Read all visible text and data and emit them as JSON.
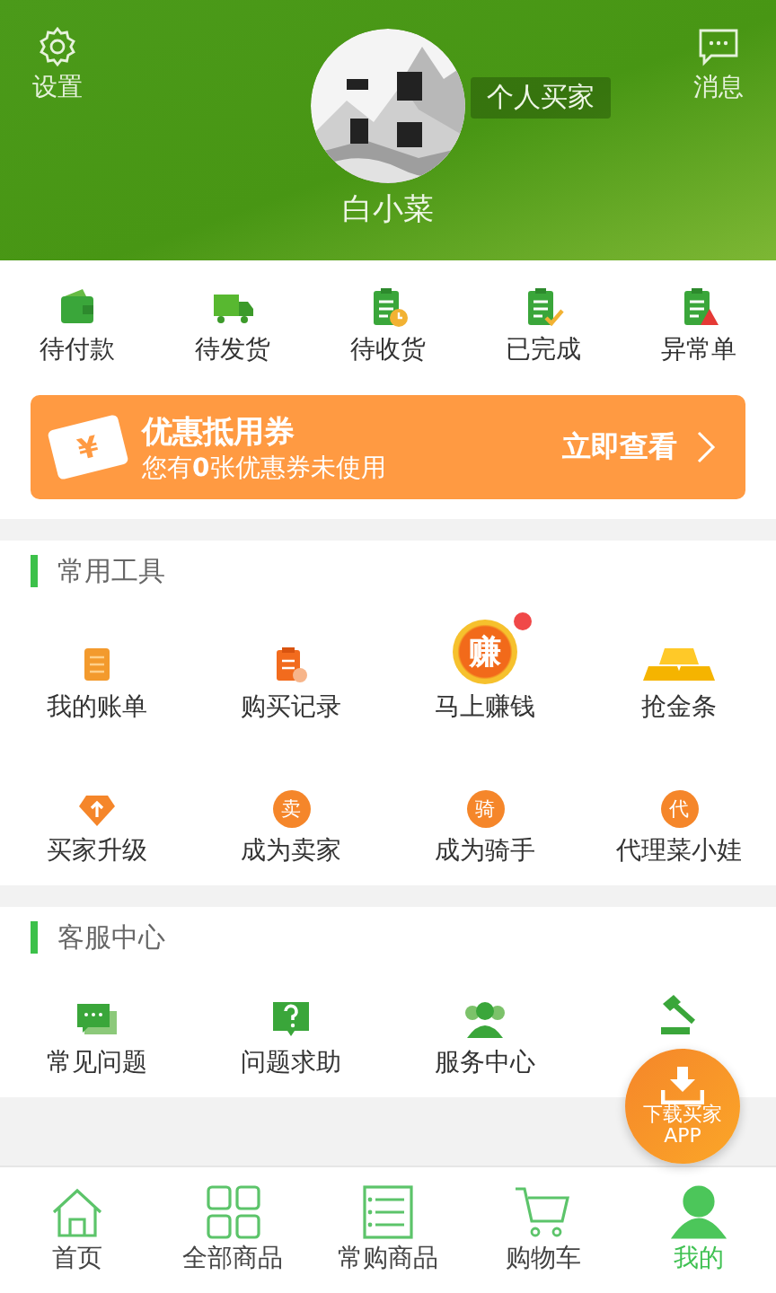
{
  "header": {
    "settings_label": "设置",
    "messages_label": "消息",
    "username": "白小菜",
    "role_tag": "个人买家"
  },
  "orders": [
    {
      "kind": "wallet",
      "label": "待付款"
    },
    {
      "kind": "truck",
      "label": "待发货"
    },
    {
      "kind": "clock",
      "label": "待收货"
    },
    {
      "kind": "check",
      "label": "已完成"
    },
    {
      "kind": "alert",
      "label": "异常单"
    }
  ],
  "coupon": {
    "icon_text": "¥",
    "title": "优惠抵用券",
    "subtitle": "您有**0**张优惠券未使用",
    "action": "立即查看"
  },
  "tools": {
    "title": "常用工具",
    "items": [
      {
        "kind": "scroll",
        "label": "我的账单",
        "dot": false
      },
      {
        "kind": "record",
        "label": "购买记录",
        "dot": false
      },
      {
        "kind": "coin",
        "icon_text": "赚",
        "label": "马上赚钱",
        "dot": true
      },
      {
        "kind": "gold",
        "label": "抢金条",
        "dot": false
      },
      {
        "kind": "diamond",
        "label": "买家升级",
        "dot": false
      },
      {
        "kind": "circle",
        "icon_text": "卖",
        "label": "成为卖家",
        "dot": false
      },
      {
        "kind": "circle",
        "icon_text": "骑",
        "label": "成为骑手",
        "dot": false
      },
      {
        "kind": "circle",
        "icon_text": "代",
        "label": "代理菜小娃",
        "dot": false
      }
    ]
  },
  "service": {
    "title": "客服中心",
    "items": [
      {
        "kind": "chat",
        "label": "常见问题"
      },
      {
        "kind": "question",
        "label": "问题求助"
      },
      {
        "kind": "people",
        "label": "服务中心"
      },
      {
        "kind": "gavel"
      }
    ]
  },
  "download_button": {
    "label": "下载买家",
    "sublabel": "APP"
  },
  "tabs": [
    {
      "kind": "home",
      "label": "首页",
      "selected": false
    },
    {
      "kind": "grid",
      "label": "全部商品",
      "selected": false
    },
    {
      "kind": "list",
      "label": "常购商品",
      "selected": false
    },
    {
      "kind": "cart",
      "label": "购物车",
      "selected": false
    },
    {
      "kind": "user",
      "label": "我的",
      "selected": true
    }
  ]
}
